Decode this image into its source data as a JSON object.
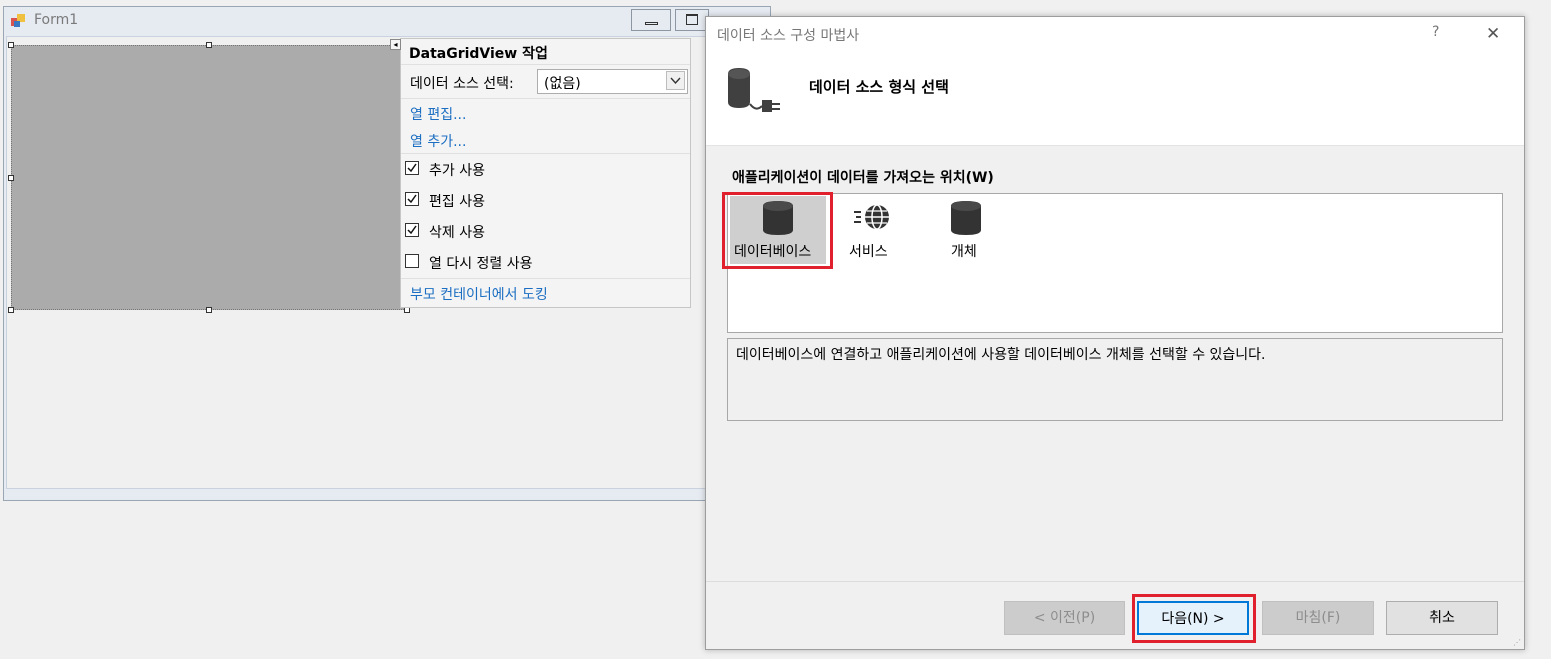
{
  "form1": {
    "title": "Form1"
  },
  "tasks": {
    "title": "DataGridView 작업",
    "datasource_label": "데이터 소스 선택:",
    "datasource_value": "(없음)",
    "edit_columns": "열 편집...",
    "add_column": "열 추가...",
    "checkboxes": [
      {
        "label": "추가 사용",
        "checked": true
      },
      {
        "label": "편집 사용",
        "checked": true
      },
      {
        "label": "삭제 사용",
        "checked": true
      },
      {
        "label": "열 다시 정렬 사용",
        "checked": false
      }
    ],
    "dock_link": "부모 컨테이너에서 도킹"
  },
  "wizard": {
    "title": "데이터 소스 구성 마법사",
    "help": "?",
    "close": "✕",
    "heading": "데이터 소스 형식 선택",
    "where_label": "애플리케이션이 데이터를 가져오는 위치(W)",
    "types": [
      {
        "label": "데이터베이스",
        "icon": "database-icon",
        "selected": true
      },
      {
        "label": "서비스",
        "icon": "service-globe-icon",
        "selected": false
      },
      {
        "label": "개체",
        "icon": "object-icon",
        "selected": false
      }
    ],
    "description": "데이터베이스에 연결하고 애플리케이션에 사용할 데이터베이스 개체를 선택할 수 있습니다.",
    "buttons": {
      "prev": "< 이전(P)",
      "next": "다음(N) >",
      "finish": "마침(F)",
      "cancel": "취소"
    },
    "highlight_color": "#e0202c",
    "accent_color": "#0078d7"
  }
}
